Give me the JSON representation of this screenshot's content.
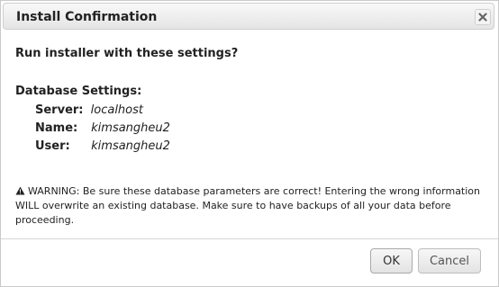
{
  "dialog": {
    "title": "Install Confirmation",
    "close_icon": "close-icon",
    "question": "Run installer with these settings?",
    "database_settings": {
      "heading": "Database Settings:",
      "server_label": "Server:",
      "server_value": "localhost",
      "name_label": "Name:",
      "name_value": "kimsangheu2",
      "user_label": "User:",
      "user_value": "kimsangheu2"
    },
    "warning": {
      "icon": "warning-icon",
      "text": "WARNING: Be sure these database parameters are correct! Entering the wrong information WILL overwrite an existing database. Make sure to have backups of all your data before proceeding."
    },
    "buttons": {
      "ok_label": "OK",
      "cancel_label": "Cancel"
    }
  }
}
